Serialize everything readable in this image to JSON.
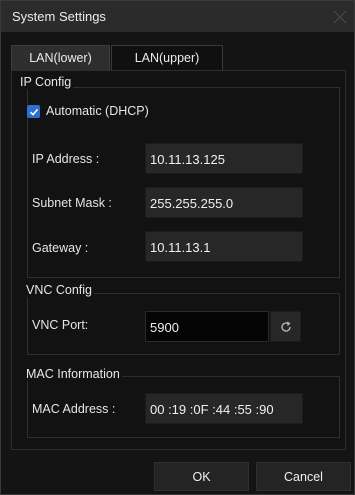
{
  "window": {
    "title": "System Settings"
  },
  "tabs": [
    {
      "label": "LAN(lower)",
      "active": true
    },
    {
      "label": "LAN(upper)",
      "active": false
    }
  ],
  "ip_config": {
    "title": "IP Config",
    "dhcp": {
      "label": "Automatic (DHCP)",
      "checked": true
    },
    "ip_address": {
      "label": "IP Address :",
      "value": "10.11.13.125"
    },
    "subnet_mask": {
      "label": "Subnet Mask :",
      "value": "255.255.255.0"
    },
    "gateway": {
      "label": "Gateway :",
      "value": "10.11.13.1"
    }
  },
  "vnc_config": {
    "title": "VNC Config",
    "port": {
      "label": "VNC Port:",
      "value": "5900"
    }
  },
  "mac_info": {
    "title": "MAC Information",
    "address": {
      "label": "MAC Address :",
      "value": "00 :19 :0F :44 :55 :90"
    }
  },
  "buttons": {
    "ok": "OK",
    "cancel": "Cancel"
  },
  "colors": {
    "accent": "#2f6fd0",
    "background": "#141414",
    "titlebar": "#2b2b2b",
    "input": "#272727"
  },
  "icons": {
    "close": "close-icon",
    "check": "checkmark-icon",
    "refresh": "refresh-icon"
  }
}
